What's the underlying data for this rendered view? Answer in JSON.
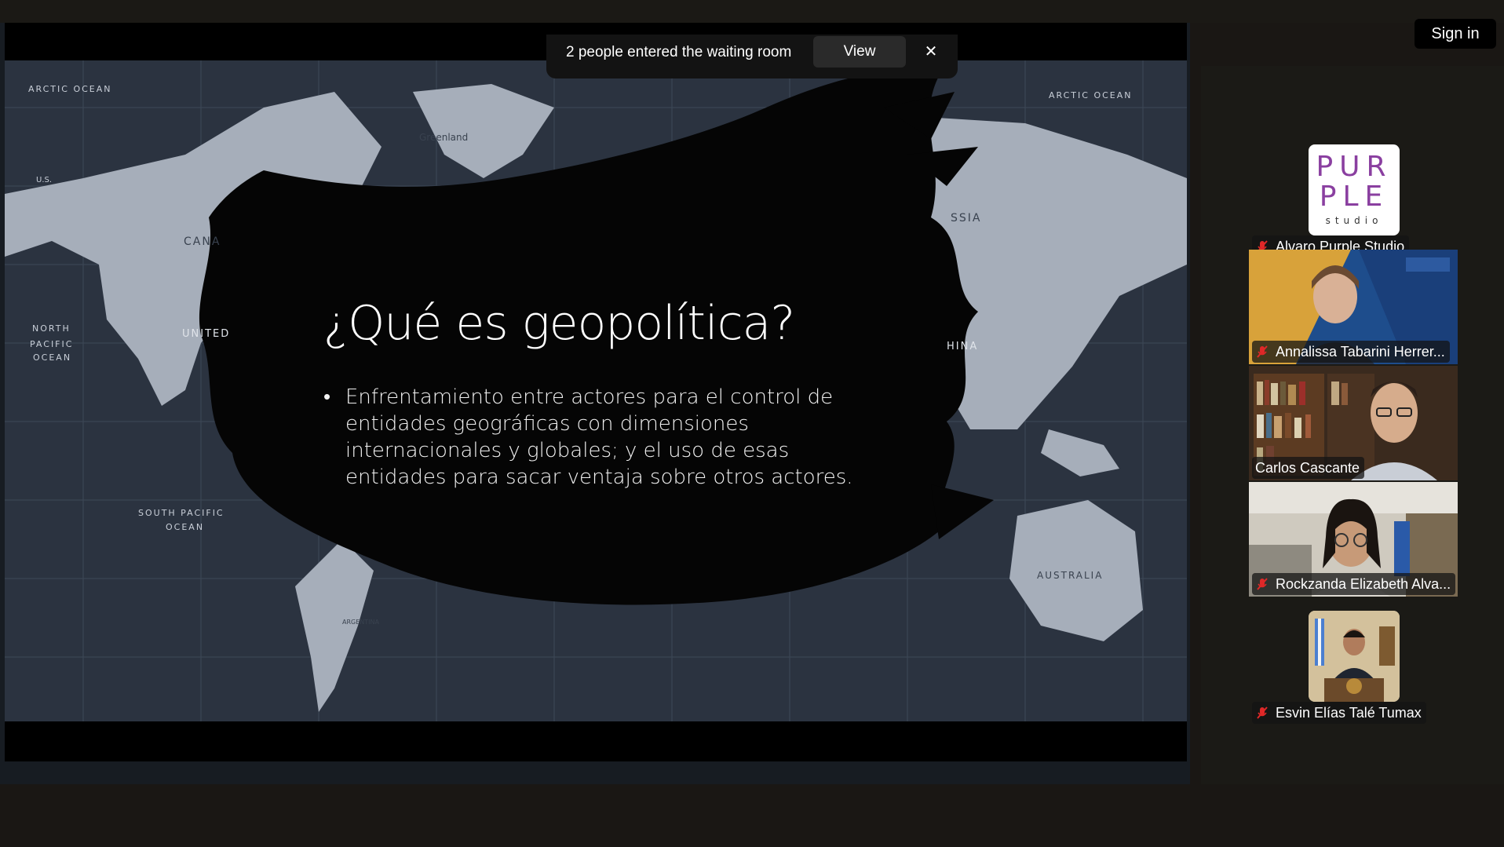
{
  "notification": {
    "text": "2 people entered the waiting room",
    "view_label": "View",
    "close_glyph": "✕"
  },
  "header": {
    "signin_label": "Sign in"
  },
  "slide": {
    "title": "¿Qué es geopolítica?",
    "bullets": [
      "Enfrentamiento entre actores para el control de entidades geográficas con dimensiones internacionales y globales; y el uso de esas entidades para sacar ventaja sobre otros actores."
    ],
    "map_labels": {
      "arctic_ocean": "ARCTIC OCEAN",
      "greenland": "Greenland",
      "canada": "CANA",
      "united": "UNITED",
      "north_pacific": "NORTH",
      "pacific": "PACIFIC",
      "ocean": "OCEAN",
      "south_pacific": "SOUTH PACIFIC",
      "russia": "SSIA",
      "china": "HINA",
      "australia": "AUSTRALIA",
      "argentina": "ARGENTINA",
      "us": "U.S."
    }
  },
  "participants": [
    {
      "name": "Alvaro Purple Studio",
      "muted": true,
      "avatar_text_1": "PUR",
      "avatar_text_2": "PLE",
      "avatar_text_3": "studio",
      "type": "avatar"
    },
    {
      "name": "Annalissa Tabarini Herrer...",
      "muted": true,
      "type": "video"
    },
    {
      "name": "Carlos Cascante",
      "muted": false,
      "active": true,
      "type": "video"
    },
    {
      "name": "Rockzanda Elizabeth Alva...",
      "muted": true,
      "type": "video"
    },
    {
      "name": "Esvin Elías Talé Tumax",
      "muted": true,
      "type": "avatar"
    }
  ],
  "colors": {
    "active_speaker": "#2bd468",
    "mute_icon": "#e02828",
    "purple_brand": "#8a3fa0"
  }
}
